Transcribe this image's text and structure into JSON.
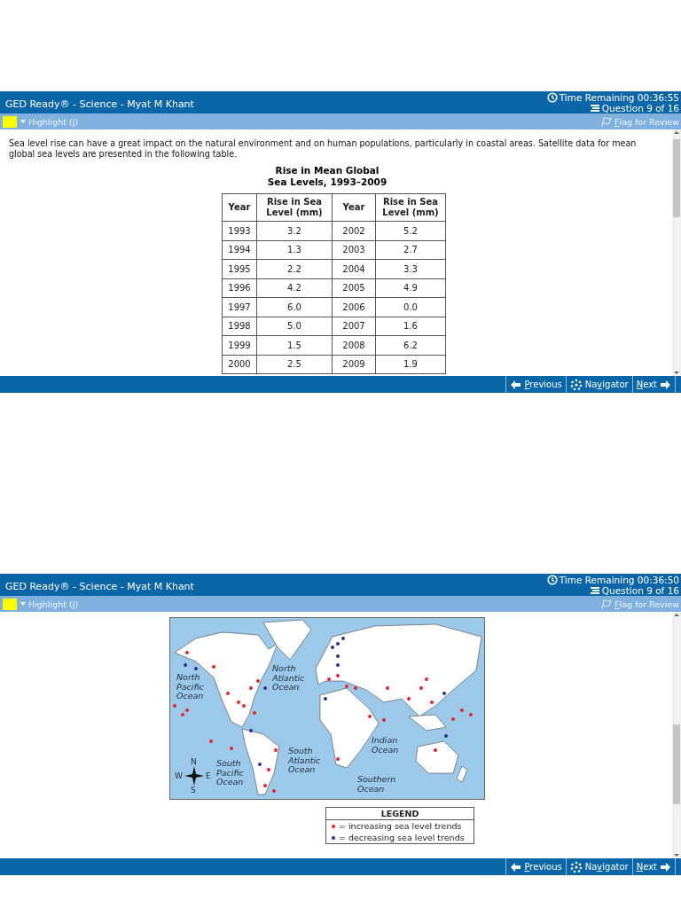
{
  "screens": [
    {
      "header": {
        "title": "GED Ready® - Science - Myat M Khant",
        "timer": "Time Remaining 00:36:55",
        "question": "Question 9 of 16"
      },
      "toolbar": {
        "highlight": {
          "before": "Highlight (",
          "key": "J",
          "after": ")"
        },
        "flag": {
          "key": "F",
          "after": "lag for Review"
        }
      },
      "content": {
        "kind": "table",
        "passage": "Sea level rise can have a great impact on the natural environment and on human populations, particularly in coastal areas. Satellite data for mean global sea levels are presented in the following table.",
        "table": {
          "title_lines": [
            "Rise in Mean Global",
            "Sea Levels, 1993–2009"
          ],
          "columns": [
            "Year",
            "Rise in Sea Level (mm)",
            "Year",
            "Rise in Sea Level (mm)"
          ],
          "rows": [
            [
              "1993",
              "3.2",
              "2002",
              "5.2"
            ],
            [
              "1994",
              "1.3",
              "2003",
              "2.7"
            ],
            [
              "1995",
              "2.2",
              "2004",
              "3.3"
            ],
            [
              "1996",
              "4.2",
              "2005",
              "4.9"
            ],
            [
              "1997",
              "6.0",
              "2006",
              "0.0"
            ],
            [
              "1998",
              "5.0",
              "2007",
              "1.6"
            ],
            [
              "1999",
              "1.5",
              "2008",
              "6.2"
            ],
            [
              "2000",
              "2.5",
              "2009",
              "1.9"
            ]
          ]
        }
      },
      "footer": {
        "buttons": [
          {
            "kind": "previous",
            "key": "P",
            "after": "revious"
          },
          {
            "kind": "navigator",
            "before": "Na",
            "key": "v",
            "after": "igator"
          },
          {
            "kind": "next",
            "key": "N",
            "after": "ext"
          }
        ]
      }
    },
    {
      "header": {
        "title": "GED Ready® - Science - Myat M Khant",
        "timer": "Time Remaining 00:36:50",
        "question": "Question 9 of 16"
      },
      "toolbar": {
        "highlight": {
          "before": "Highlight (",
          "key": "J",
          "after": ")"
        },
        "flag": {
          "key": "F",
          "after": "lag for Review"
        }
      },
      "content": {
        "kind": "map",
        "map": {
          "kind": "picture",
          "labels": [
            "North Pacific Ocean",
            "North Atlantic Ocean",
            "South Atlantic Ocean",
            "Indian Ocean",
            "South Pacific Ocean",
            "Southern Ocean"
          ],
          "compass": [
            "N",
            "E",
            "S",
            "W"
          ]
        },
        "legend": {
          "title": "LEGEND",
          "items": [
            {
              "color": "#e42228",
              "text": "= increasing sea level trends"
            },
            {
              "color": "#26308c",
              "text": "= decreasing sea level trends"
            }
          ]
        }
      },
      "footer": {
        "buttons": [
          {
            "kind": "previous",
            "key": "P",
            "after": "revious"
          },
          {
            "kind": "navigator",
            "before": "Na",
            "key": "v",
            "after": "igator"
          },
          {
            "kind": "next",
            "key": "N",
            "after": "ext"
          }
        ]
      }
    }
  ]
}
